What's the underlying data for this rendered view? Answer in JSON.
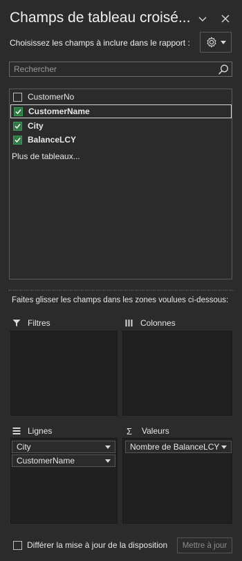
{
  "panel": {
    "title": "Champs de tableau croisé...",
    "subtitle": "Choisissez les champs à inclure dans le rapport :",
    "menu_icon": "chevron-down-icon",
    "close_icon": "close-icon",
    "settings_icon": "gear-icon"
  },
  "search": {
    "placeholder": "Rechercher",
    "value": ""
  },
  "fields": [
    {
      "label": "CustomerNo",
      "checked": false
    },
    {
      "label": "CustomerName",
      "checked": true
    },
    {
      "label": "City",
      "checked": true
    },
    {
      "label": "BalanceLCY",
      "checked": true
    }
  ],
  "more_tables": "Plus de tableaux...",
  "drag_hint": "Faites glisser les champs dans les zones voulues ci-dessous:",
  "zones": {
    "filters": {
      "label": "Filtres",
      "items": []
    },
    "columns": {
      "label": "Colonnes",
      "items": []
    },
    "rows": {
      "label": "Lignes",
      "items": [
        "City",
        "CustomerName"
      ]
    },
    "values": {
      "label": "Valeurs",
      "items": [
        "Nombre de BalanceLCY"
      ]
    }
  },
  "footer": {
    "defer_label": "Différer la mise à jour de la disposition",
    "defer_checked": false,
    "update_label": "Mettre à jour"
  },
  "colors": {
    "background": "#2b2b2b",
    "zone_background": "#202020",
    "checkbox_checked": "#2f7a44",
    "text": "#e8e8e8"
  }
}
